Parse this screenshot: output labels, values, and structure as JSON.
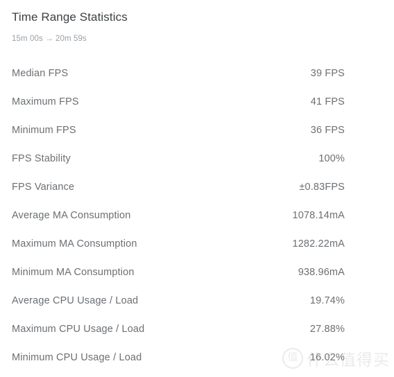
{
  "panel": {
    "title": "Time Range Statistics",
    "subtitle": "15m 00s → 20m 59s"
  },
  "stats": [
    {
      "label": "Median FPS",
      "value": "39 FPS"
    },
    {
      "label": "Maximum FPS",
      "value": "41 FPS"
    },
    {
      "label": "Minimum FPS",
      "value": "36 FPS"
    },
    {
      "label": "FPS Stability",
      "value": "100%"
    },
    {
      "label": "FPS Variance",
      "value": "±0.83FPS"
    },
    {
      "label": "Average MA Consumption",
      "value": "1078.14mA"
    },
    {
      "label": "Maximum MA Consumption",
      "value": "1282.22mA"
    },
    {
      "label": "Minimum MA Consumption",
      "value": "938.96mA"
    },
    {
      "label": "Average CPU Usage / Load",
      "value": "19.74%"
    },
    {
      "label": "Maximum CPU Usage / Load",
      "value": "27.88%"
    },
    {
      "label": "Minimum CPU Usage / Load",
      "value": "16.02%"
    }
  ],
  "watermark": {
    "mark": "值",
    "text": "什么值得买"
  },
  "colors": {
    "background": "#ffffff",
    "title_text": "#3c4043",
    "row_text": "#6b6f73",
    "subtitle_text": "#9aa0a6"
  }
}
